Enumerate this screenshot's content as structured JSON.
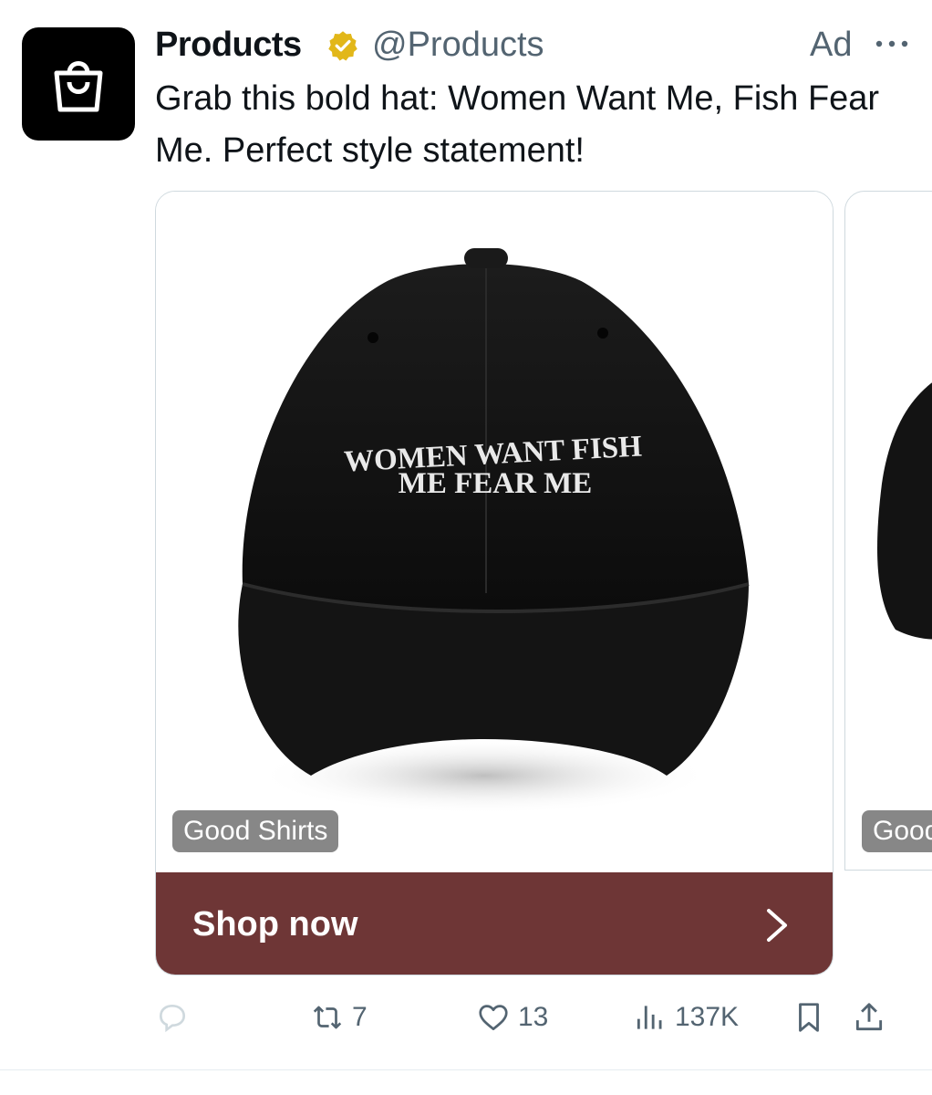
{
  "ad": {
    "account_name": "Products",
    "handle": "@Products",
    "label": "Ad",
    "text": "Grab this bold hat: Women Want Me, Fish Fear Me. Perfect style statement!"
  },
  "card": {
    "cap_text_line1": "WOMEN  WANT  FISH",
    "cap_text_line2": "ME  FEAR  ME",
    "source": "Good Shirts",
    "cta_label": "Shop now"
  },
  "card_next": {
    "source": "Good Shirts"
  },
  "metrics": {
    "reposts": "7",
    "likes": "13",
    "views": "137K"
  },
  "colors": {
    "cta_background": "#6e3636",
    "verified_badge": "#e2b719",
    "muted_text": "#536471"
  },
  "icons": [
    "shopping-bag-icon",
    "verified-badge-icon",
    "more-icon",
    "chevron-right-icon",
    "reply-icon",
    "repost-icon",
    "like-icon",
    "views-icon",
    "bookmark-icon",
    "share-icon"
  ]
}
